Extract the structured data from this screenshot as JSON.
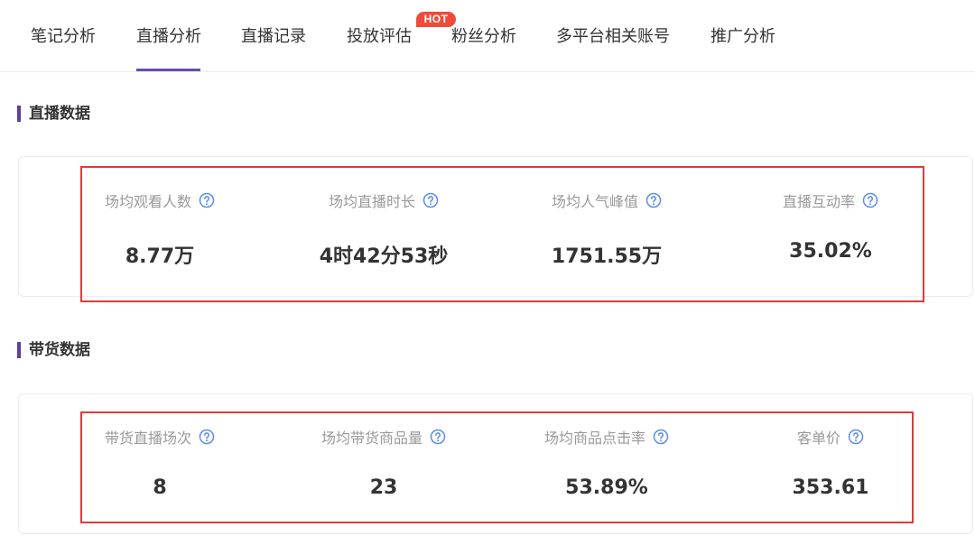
{
  "tabs": [
    {
      "label": "笔记分析"
    },
    {
      "label": "直播分析"
    },
    {
      "label": "直播记录"
    },
    {
      "label": "投放评估"
    },
    {
      "label": "粉丝分析"
    },
    {
      "label": "多平台相关账号"
    },
    {
      "label": "推广分析"
    }
  ],
  "active_tab": "直播分析",
  "hot_badge": "HOT",
  "live_section": {
    "title": "直播数据",
    "metrics": [
      {
        "label": "场均观看人数",
        "value": "8.77万"
      },
      {
        "label": "场均直播时长",
        "value": "4时42分53秒"
      },
      {
        "label": "场均人气峰值",
        "value": "1751.55万"
      },
      {
        "label": "直播互动率",
        "value": "35.02%"
      }
    ]
  },
  "sales_section": {
    "title": "带货数据",
    "metrics": [
      {
        "label": "带货直播场次",
        "value": "8"
      },
      {
        "label": "场均带货商品量",
        "value": "23"
      },
      {
        "label": "场均商品点击率",
        "value": "53.89%"
      },
      {
        "label": "客单价",
        "value": "353.61"
      }
    ]
  },
  "colors": {
    "accent": "#5b3fa2",
    "hot": "#f04a3b",
    "highlight_box": "#e03a3a",
    "help_icon": "#5b8def"
  },
  "icons": {
    "help": "question-circle-icon"
  }
}
